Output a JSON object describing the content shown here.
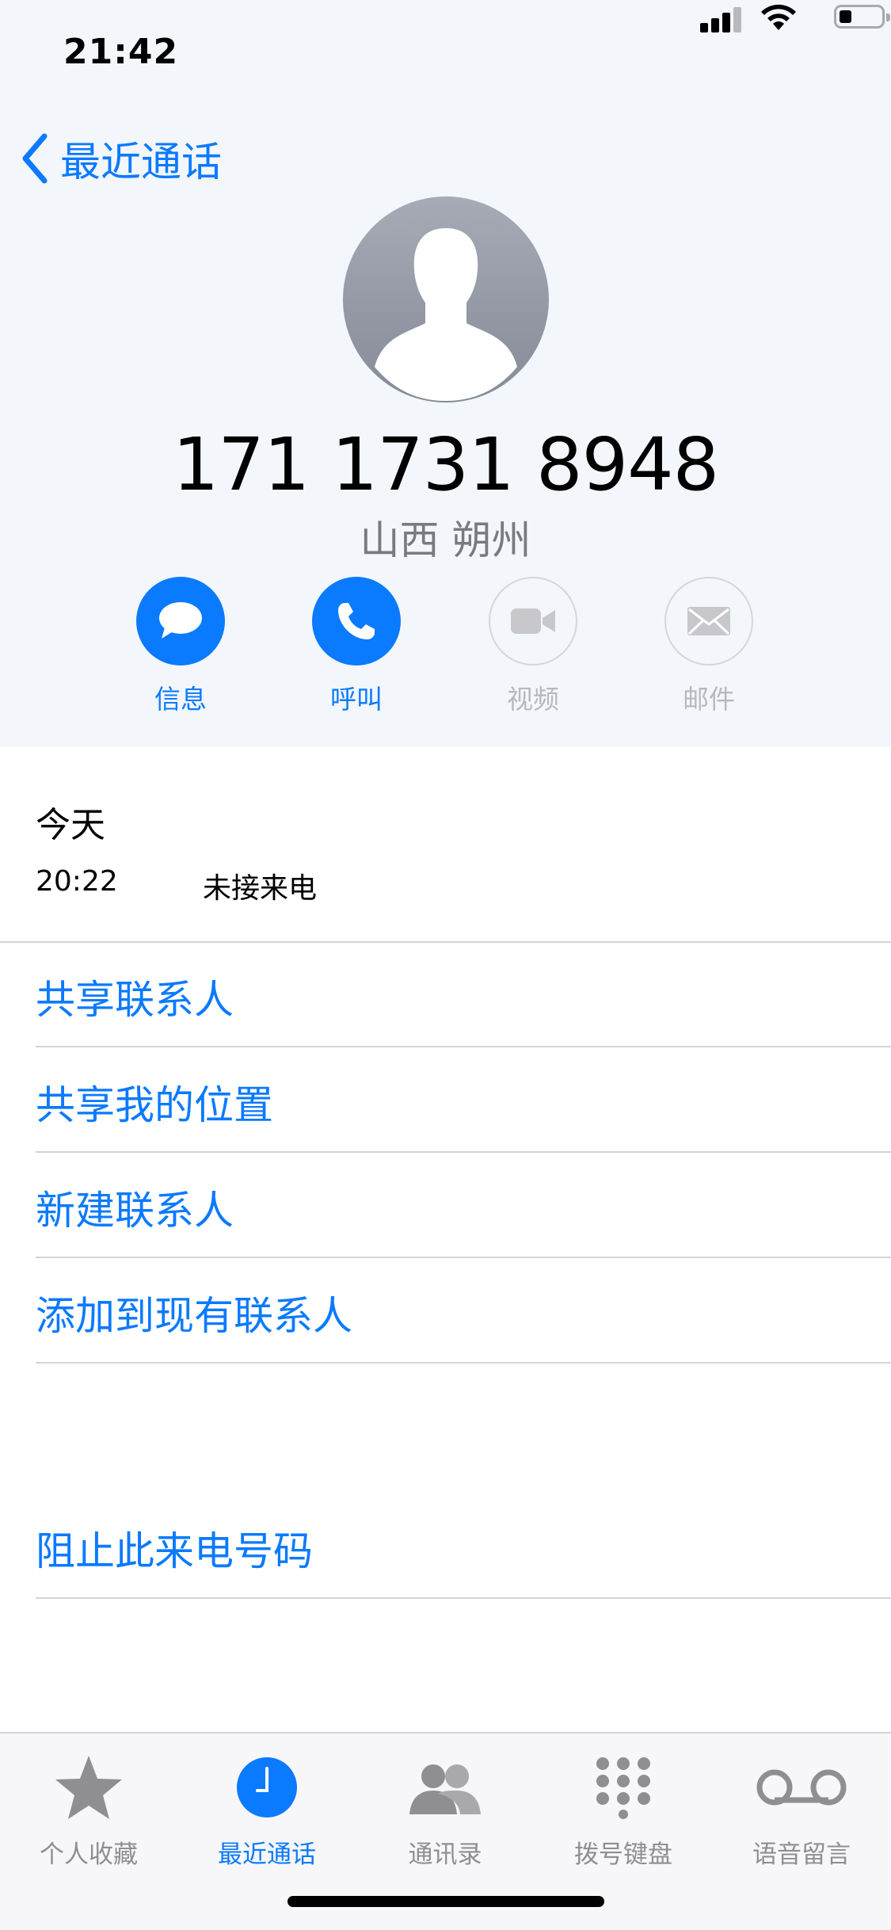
{
  "status_bar": {
    "time": "21:42"
  },
  "nav": {
    "back_label": "最近通话"
  },
  "contact": {
    "number": "171 1731 8948",
    "location": "山西 朔州"
  },
  "actions": [
    {
      "label": "信息",
      "icon": "message-icon",
      "enabled": true
    },
    {
      "label": "呼叫",
      "icon": "phone-icon",
      "enabled": true
    },
    {
      "label": "视频",
      "icon": "video-icon",
      "enabled": false
    },
    {
      "label": "邮件",
      "icon": "mail-icon",
      "enabled": false
    }
  ],
  "recent": {
    "day": "今天",
    "entries": [
      {
        "time": "20:22",
        "status": "未接来电"
      }
    ]
  },
  "menu": {
    "share_contact": "共享联系人",
    "share_location": "共享我的位置",
    "new_contact": "新建联系人",
    "add_existing": "添加到现有联系人",
    "block": "阻止此来电号码"
  },
  "tabs": [
    {
      "label": "个人收藏",
      "icon": "star-icon"
    },
    {
      "label": "最近通话",
      "icon": "clock-icon",
      "selected": true
    },
    {
      "label": "通讯录",
      "icon": "contacts-icon"
    },
    {
      "label": "拨号键盘",
      "icon": "keypad-icon"
    },
    {
      "label": "语音留言",
      "icon": "voicemail-icon"
    }
  ],
  "colors": {
    "accent": "#0a7aff",
    "header_bg": "#f3f6fb",
    "tab_inactive": "#8e8e93"
  }
}
